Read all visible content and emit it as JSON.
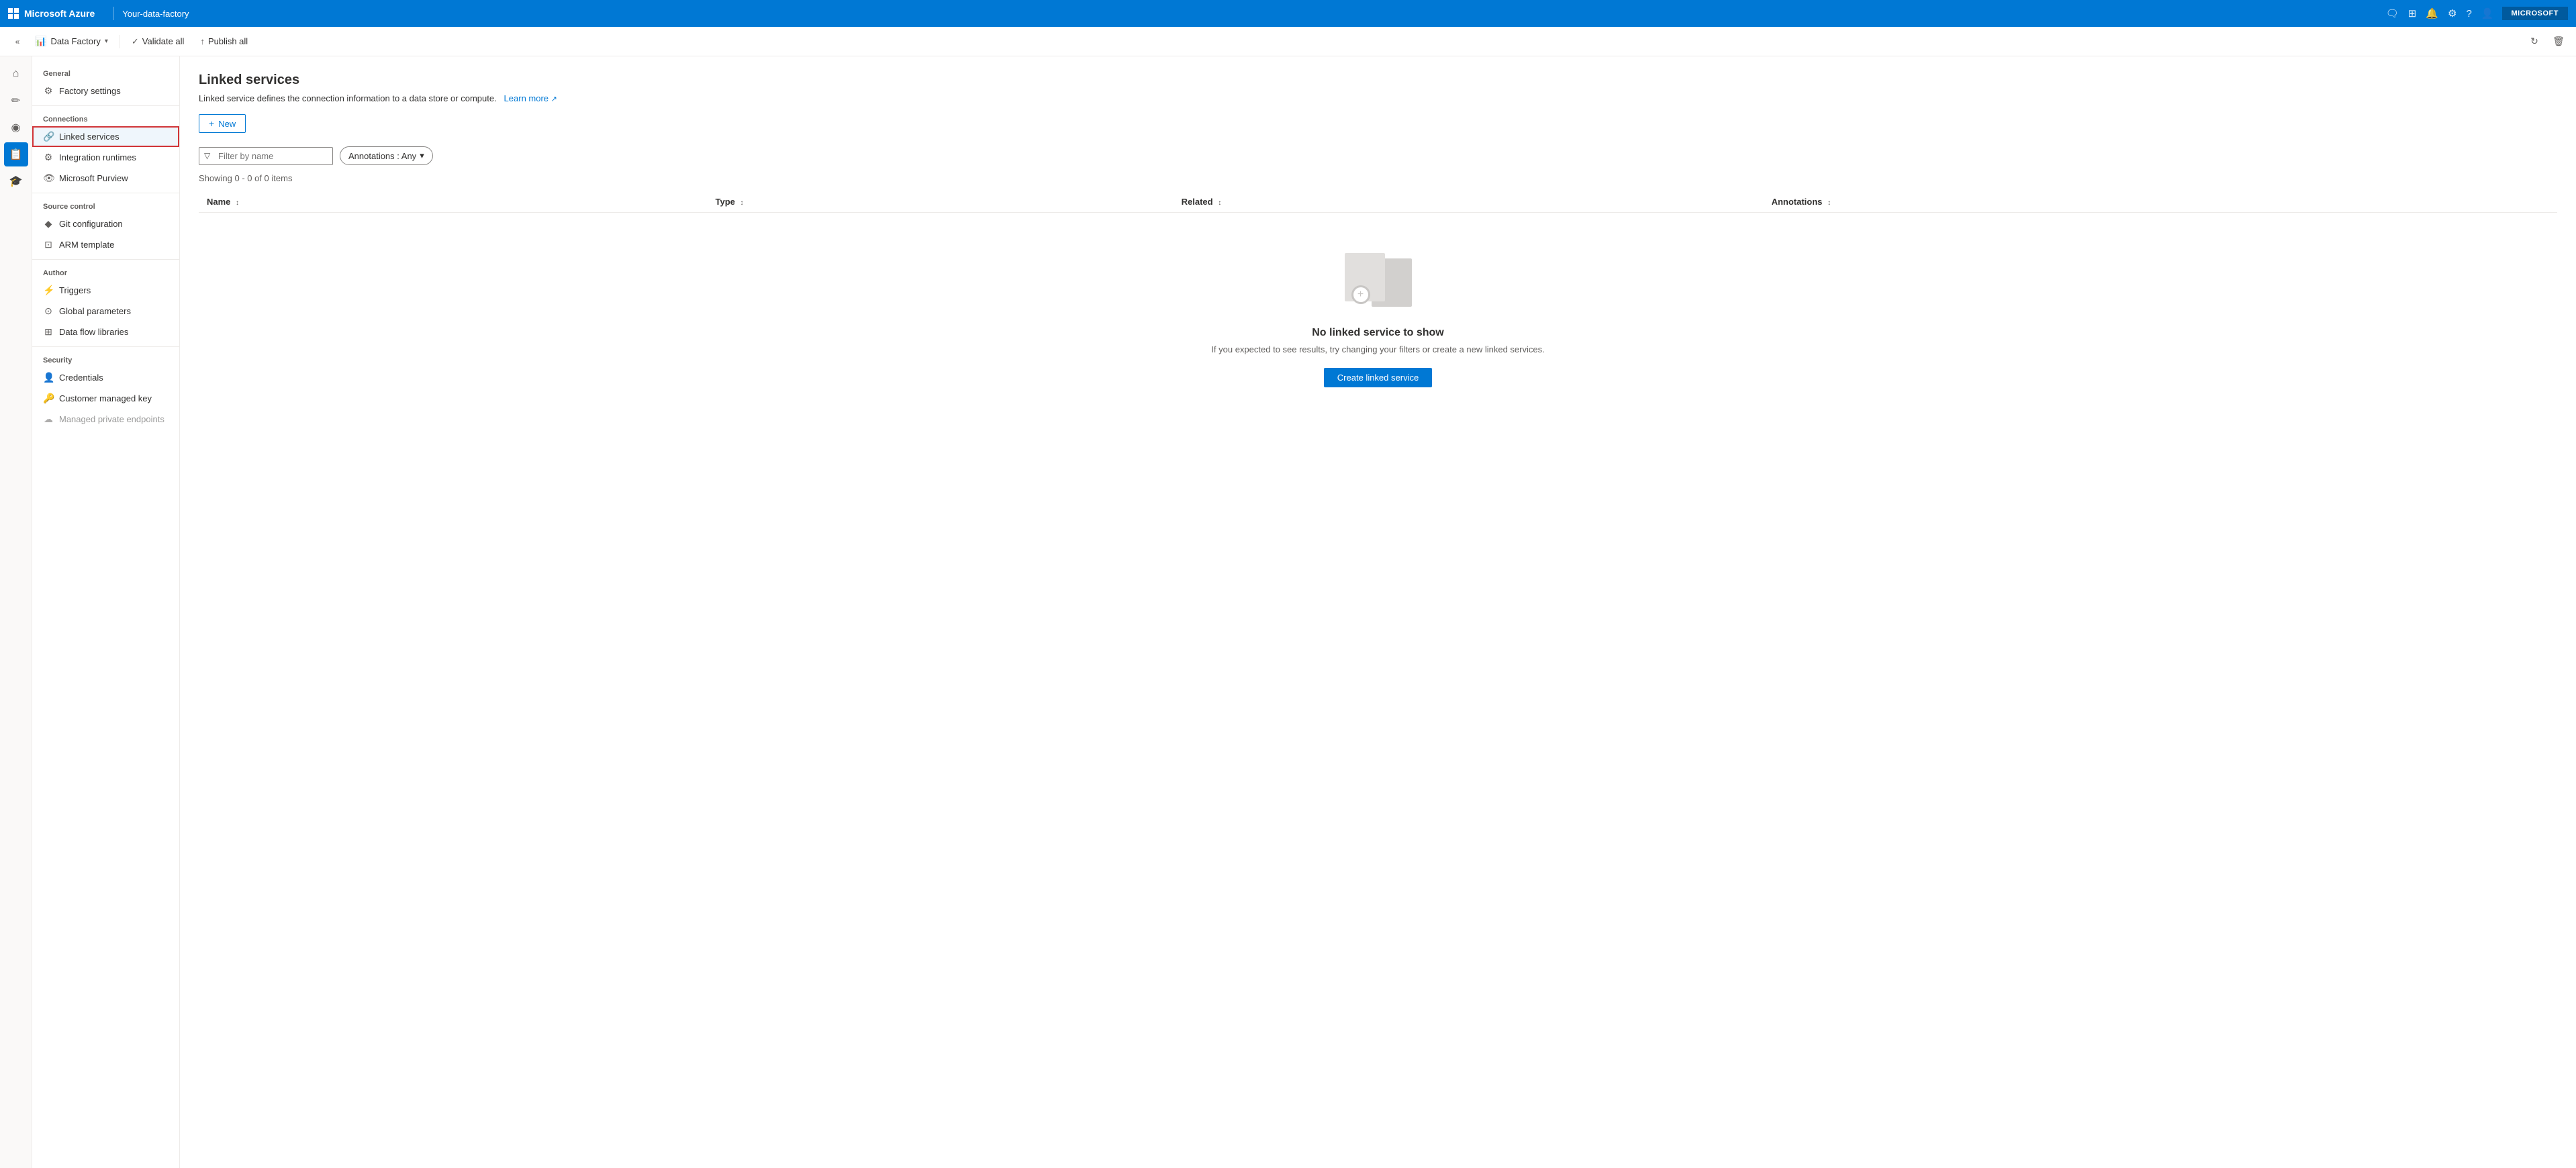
{
  "topbar": {
    "brand": "Microsoft Azure",
    "separator": "|",
    "factory_name": "Your-data-factory",
    "user_label": "MICROSOFT",
    "icons": [
      "feedback-icon",
      "portal-icon",
      "notification-icon",
      "settings-icon",
      "help-icon",
      "user-icon"
    ]
  },
  "second_toolbar": {
    "collapse_label": "«",
    "section_label": "Data Factory",
    "section_chevron": "▾",
    "validate_all_label": "Validate all",
    "publish_all_label": "Publish all",
    "refresh_icon": "↻",
    "discard_icon": "🗑"
  },
  "nav_icons": [
    {
      "name": "home-icon",
      "symbol": "⌂",
      "active": false
    },
    {
      "name": "pencil-icon",
      "symbol": "✏",
      "active": false
    },
    {
      "name": "monitor-icon",
      "symbol": "◉",
      "active": false
    },
    {
      "name": "briefcase-icon",
      "symbol": "📋",
      "active": true
    },
    {
      "name": "graduation-icon",
      "symbol": "🎓",
      "active": false
    }
  ],
  "sidebar": {
    "general_label": "General",
    "factory_settings_label": "Factory settings",
    "connections_label": "Connections",
    "linked_services_label": "Linked services",
    "integration_runtimes_label": "Integration runtimes",
    "microsoft_purview_label": "Microsoft Purview",
    "source_control_label": "Source control",
    "git_configuration_label": "Git configuration",
    "arm_template_label": "ARM template",
    "author_label": "Author",
    "triggers_label": "Triggers",
    "global_parameters_label": "Global parameters",
    "data_flow_libraries_label": "Data flow libraries",
    "security_label": "Security",
    "credentials_label": "Credentials",
    "customer_managed_key_label": "Customer managed key",
    "managed_private_endpoints_label": "Managed private endpoints"
  },
  "content": {
    "page_title": "Linked services",
    "description": "Linked service defines the connection information to a data store or compute.",
    "learn_more_label": "Learn more",
    "new_button_label": "New",
    "filter_placeholder": "Filter by name",
    "annotations_label": "Annotations : Any",
    "results_count": "Showing 0 - 0 of 0 items",
    "table": {
      "columns": [
        {
          "label": "Name",
          "sort": "↕"
        },
        {
          "label": "Type",
          "sort": "↕"
        },
        {
          "label": "Related",
          "sort": "↕"
        },
        {
          "label": "Annotations",
          "sort": "↕"
        }
      ]
    },
    "empty_state": {
      "title": "No linked service to show",
      "description": "If you expected to see results, try changing your filters or create a new linked services.",
      "create_button_label": "Create linked service"
    }
  }
}
